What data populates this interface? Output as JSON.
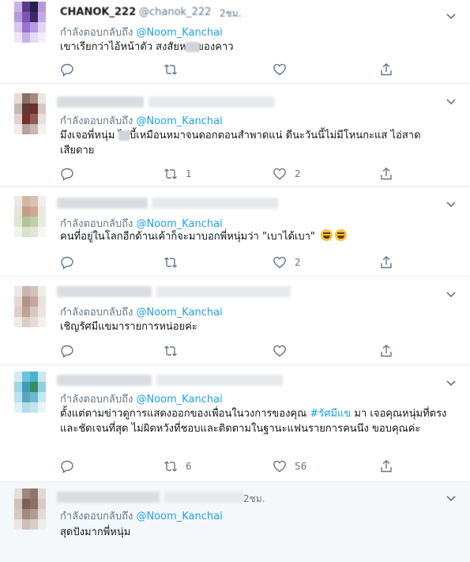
{
  "thread": {
    "tweets": [
      {
        "author_name": "CHANOK_222",
        "author_handle": "@chanok_222",
        "time": "2ชม.",
        "reply_prefix": "กำลังตอบกลับถึง",
        "reply_handle": "@Noom_Kanchai",
        "text": "เขาเรียกว่าไอ้หน้าตัว    สงสัยหวงของคาว",
        "replies": "",
        "retweets": "",
        "likes": ""
      },
      {
        "reply_prefix": "กำลังตอบกลับถึง",
        "reply_handle": "@Noom_Kanchai",
        "text": "มึงเจอพี่หนุ่ม   ไล่บี้เหมือนหมาจนดอกตอนสำพาดแน่ ดีนะวันนี้ไม่มีโหนกะแส ไอ่สาดเสียดาย",
        "retweets": "1",
        "likes": "2"
      },
      {
        "reply_prefix": "กำลังตอบกลับถึง",
        "reply_handle": "@Noom_Kanchai",
        "text": "คนที่อยู่ในโลกอีกด้านเค้าก็จะมาบอกพี่หนุ่มว่า \"เบาได้เบา\"",
        "retweets": "",
        "likes": "2"
      },
      {
        "reply_prefix": "กำลังตอบกลับถึง",
        "reply_handle": "@Noom_Kanchai",
        "text": "เชิญรัศมีแขมารายการหน่อยค่ะ",
        "retweets": "",
        "likes": ""
      },
      {
        "reply_prefix": "กำลังตอบกลับถึง",
        "reply_handle": "@Noom_Kanchai",
        "text_before": "ตั้งแต่ตามข่าวดูการแสดงออกของเพื่อนในวงการของคุณ ",
        "hashtag": "#รัศมีแข",
        "text_after": " มา เจอคุณหนุ่มที่ตรงและชัดเจนที่สุด ไม่ผิดหวังที่ชอบและติดตามในฐานะแฟนรายการคนนึง ขอบคุณค่ะ",
        "retweets": "6",
        "likes": "56"
      },
      {
        "time": "2ชม.",
        "reply_prefix": "กำลังตอบกลับถึง",
        "reply_handle": "@Noom_Kanchai",
        "text": "สุดปังมากพี่หนุ่ม"
      }
    ]
  },
  "colors": {
    "accent": "#1da1f2",
    "muted": "#657786",
    "divider": "#e6ecf0",
    "highlight_bg": "#f5f8fa"
  },
  "icons": [
    "chevron-down-icon",
    "reply-icon",
    "retweet-icon",
    "like-icon",
    "share-icon",
    "emoji-laughing-icon"
  ]
}
